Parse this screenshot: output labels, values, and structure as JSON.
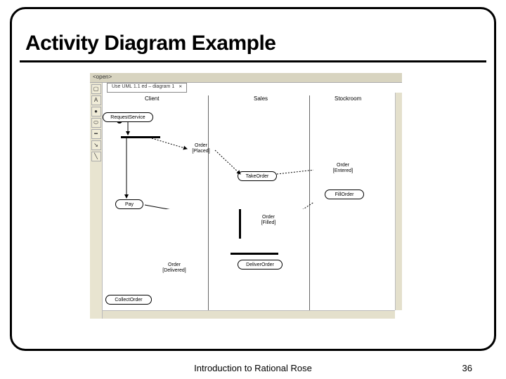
{
  "slide": {
    "title": "Activity Diagram Example",
    "footer": "Introduction to Rational Rose",
    "page_number": "36"
  },
  "app": {
    "title": "<open>",
    "doc_tab": "Use UML 1.1 ed – diagram 1",
    "lanes": {
      "client": "Client",
      "sales": "Sales",
      "stockroom": "Stockroom"
    },
    "tools": {
      "select": "▢",
      "text": "A",
      "initial": "●",
      "activity": "⬭",
      "sync": "━",
      "arrow": "↘",
      "line": "╲"
    }
  },
  "nodes": {
    "request_service": "RequestService",
    "take_order": "TakeOrder",
    "pay": "Pay",
    "fill_order": "FillOrder",
    "deliver_order": "DeliverOrder",
    "collect_order": "CollectOrder",
    "order_placed": "Order\n[Placed]",
    "order_entered": "Order\n[Entered]",
    "order_filled": "Order\n[Filled]",
    "order_delivered": "Order\n[Delivered]"
  }
}
